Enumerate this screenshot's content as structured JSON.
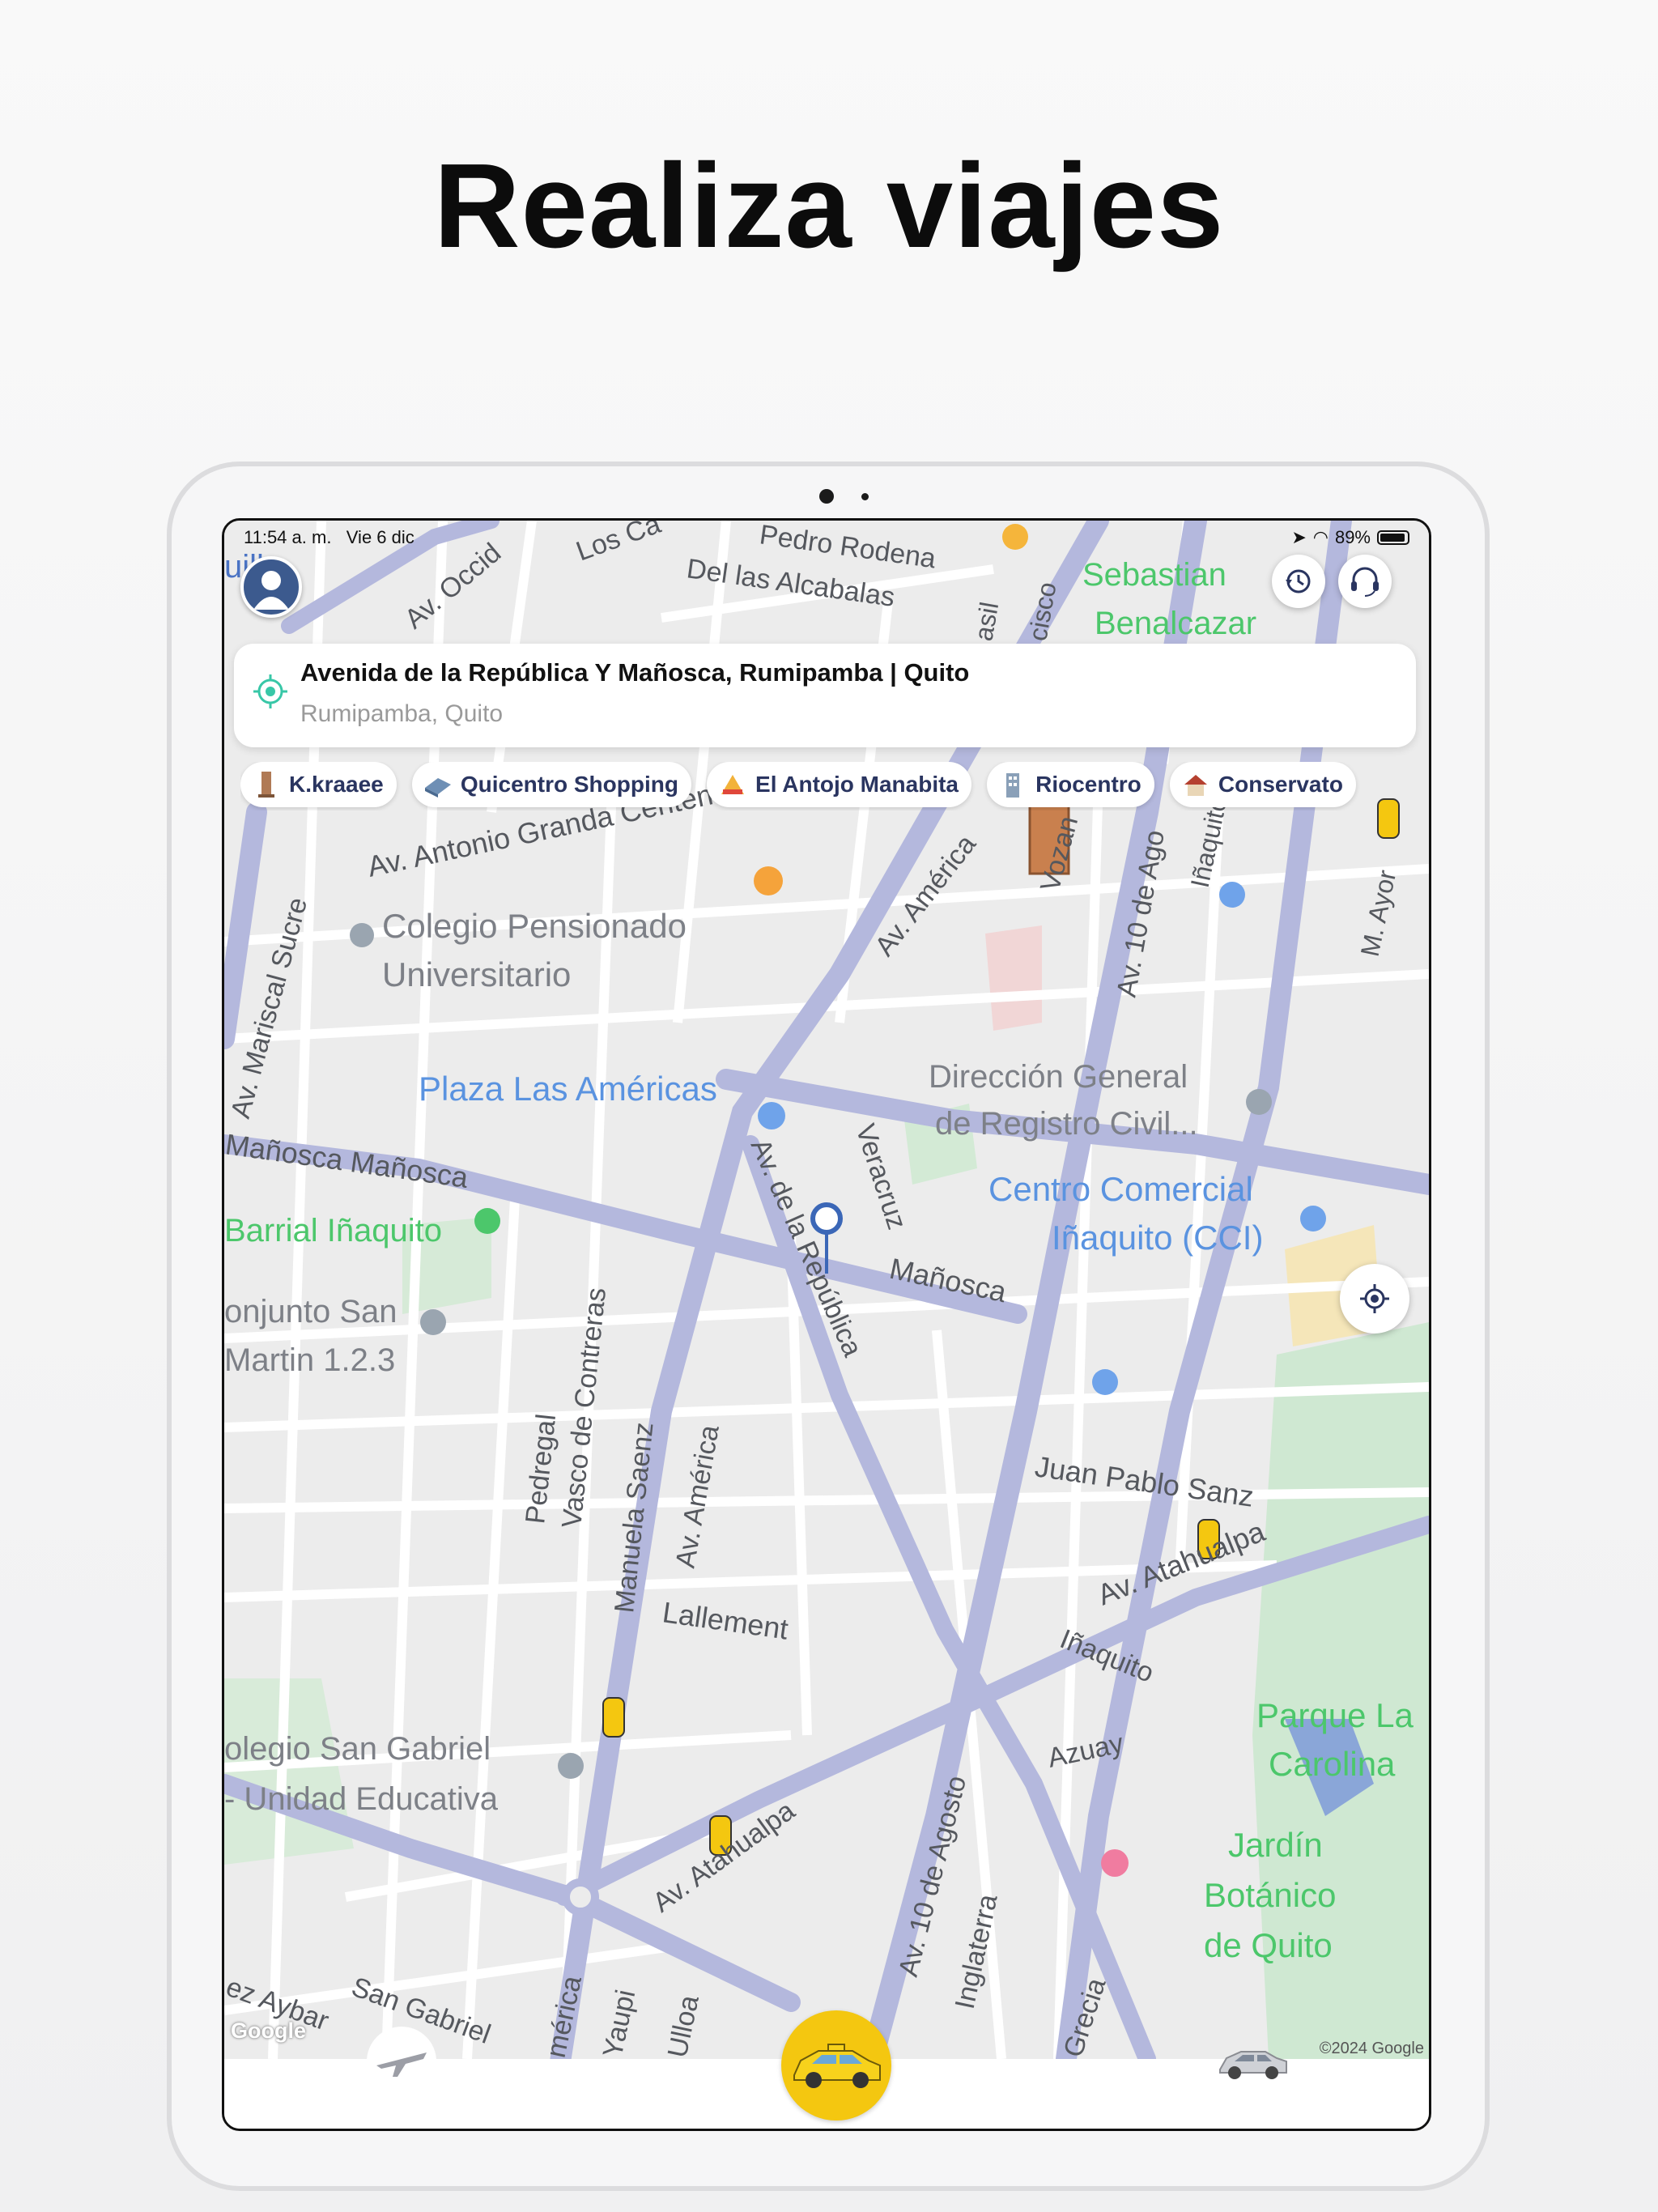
{
  "headline": "Realiza viajes",
  "status_bar": {
    "time": "11:54 a. m.",
    "date": "Vie 6 dic",
    "battery": "89%"
  },
  "address": {
    "main": "Avenida de la República Y Mañosca, Rumipamba | Quito",
    "sub": "Rumipamba, Quito"
  },
  "places": [
    {
      "label": "K.kraaee"
    },
    {
      "label": "Quicentro Shopping"
    },
    {
      "label": "El Antojo Manabita"
    },
    {
      "label": "Riocentro"
    },
    {
      "label": "Conservato"
    }
  ],
  "map_labels": {
    "occid": "Av. Occid",
    "los_ca": "Los Ca",
    "pedro_rodena": "Pedro Rodena",
    "alcabalas": "Del las Alcabalas",
    "brasil": "asil",
    "cisco": "cisco",
    "sebastian": "Sebastian",
    "benalcazar": "Benalcazar",
    "quilla": "uilla",
    "antonio_granda": "Av. Antonio Granda Centeno",
    "colegio_pens1": "Colegio Pensionado",
    "colegio_pens2": "Universitario",
    "av_america_n": "Av. América",
    "vozandes": "Vozan",
    "av10_n": "Av. 10 de Ago",
    "inaquito_n": "Iñaquito",
    "ayora": "M. Ayor",
    "mariscal": "Av. Mariscal Sucre",
    "plaza": "Plaza Las Américas",
    "direccion1": "Dirección General",
    "direccion2": "de Registro Civil...",
    "manosca_w": "Mañosca Mañosca",
    "av_republica": "Av. de la República",
    "veracruz": "Veracruz",
    "cci1": "Centro Comercial",
    "cci2": "Iñaquito (CCI)",
    "barrial": "Barrial Iñaquito",
    "manosca_e": "Mañosca",
    "conjunto1": "onjunto San",
    "conjunto2": "Martin 1.2.3",
    "pedregal": "Pedregal",
    "vasco": "Vasco de Contreras",
    "manuela": "Manuela Saenz",
    "av_america_s": "Av. América",
    "juan_pablo": "Juan Pablo Sanz",
    "atahualpa_e": "Av. Atahualpa",
    "lallement": "Lallement",
    "inaquito_s": "Iñaquito",
    "parque1": "Parque La",
    "parque2": "Carolina",
    "gabriel1": "olegio San Gabriel",
    "gabriel2": "- Unidad Educativa",
    "azuay": "Azuay",
    "atahualpa_w": "Av. Atahualpa",
    "jardin1": "Jardín",
    "jardin2": "Botánico",
    "jardin3": "de Quito",
    "av10_s": "Av. 10 de Agosto",
    "inglaterra": "Inglaterra",
    "ez_aybar": "ez Aybar",
    "san_gabriel": "San Gabriel",
    "america_sw": "mérica",
    "yaupi": "Yaupi",
    "ulloa": "Ulloa",
    "grecia": "Grecia"
  },
  "google": "Google",
  "copyright": "©2024 Google",
  "colors": {
    "main_road": "#b4b8dd",
    "route": "#3b67b7",
    "park_label": "#4cc76b",
    "poi_label": "#5a93e0",
    "taxi": "#f4c710"
  },
  "icons": {
    "history": "history-icon",
    "support": "headset-icon",
    "locate": "crosshair-icon",
    "origin": "origin-pin-icon"
  }
}
